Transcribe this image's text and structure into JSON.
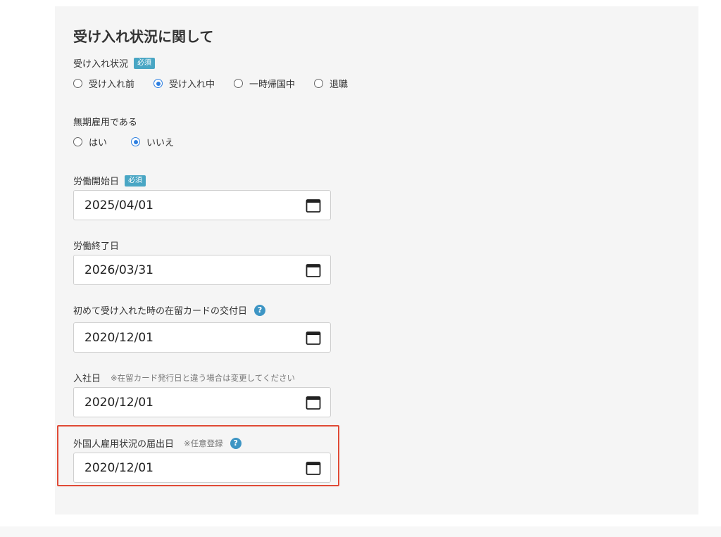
{
  "section_title": "受け入れ状況に関して",
  "required_badge": "必須",
  "acceptance": {
    "label": "受け入れ状況",
    "options": [
      "受け入れ前",
      "受け入れ中",
      "一時帰国中",
      "退職"
    ],
    "selected": "受け入れ中"
  },
  "indefinite": {
    "label": "無期雇用である",
    "options": [
      "はい",
      "いいえ"
    ],
    "selected": "いいえ"
  },
  "work_start": {
    "label": "労働開始日",
    "value": "2025/04/01"
  },
  "work_end": {
    "label": "労働終了日",
    "value": "2026/03/31"
  },
  "residence_card": {
    "label": "初めて受け入れた時の在留カードの交付日",
    "value": "2020/12/01"
  },
  "join_date": {
    "label": "入社日",
    "note": "※在留カード発行日と違う場合は変更してください",
    "value": "2020/12/01"
  },
  "notification": {
    "label": "外国人雇用状況の届出日",
    "note": "※任意登録",
    "value": "2020/12/01"
  },
  "help_glyph": "?",
  "icons": {
    "calendar": "calendar-icon",
    "help": "help-icon"
  },
  "colors": {
    "badge": "#49a6c4",
    "radio_selected": "#2d7fe0",
    "highlight": "#e04a36",
    "help": "#3d95c4"
  }
}
